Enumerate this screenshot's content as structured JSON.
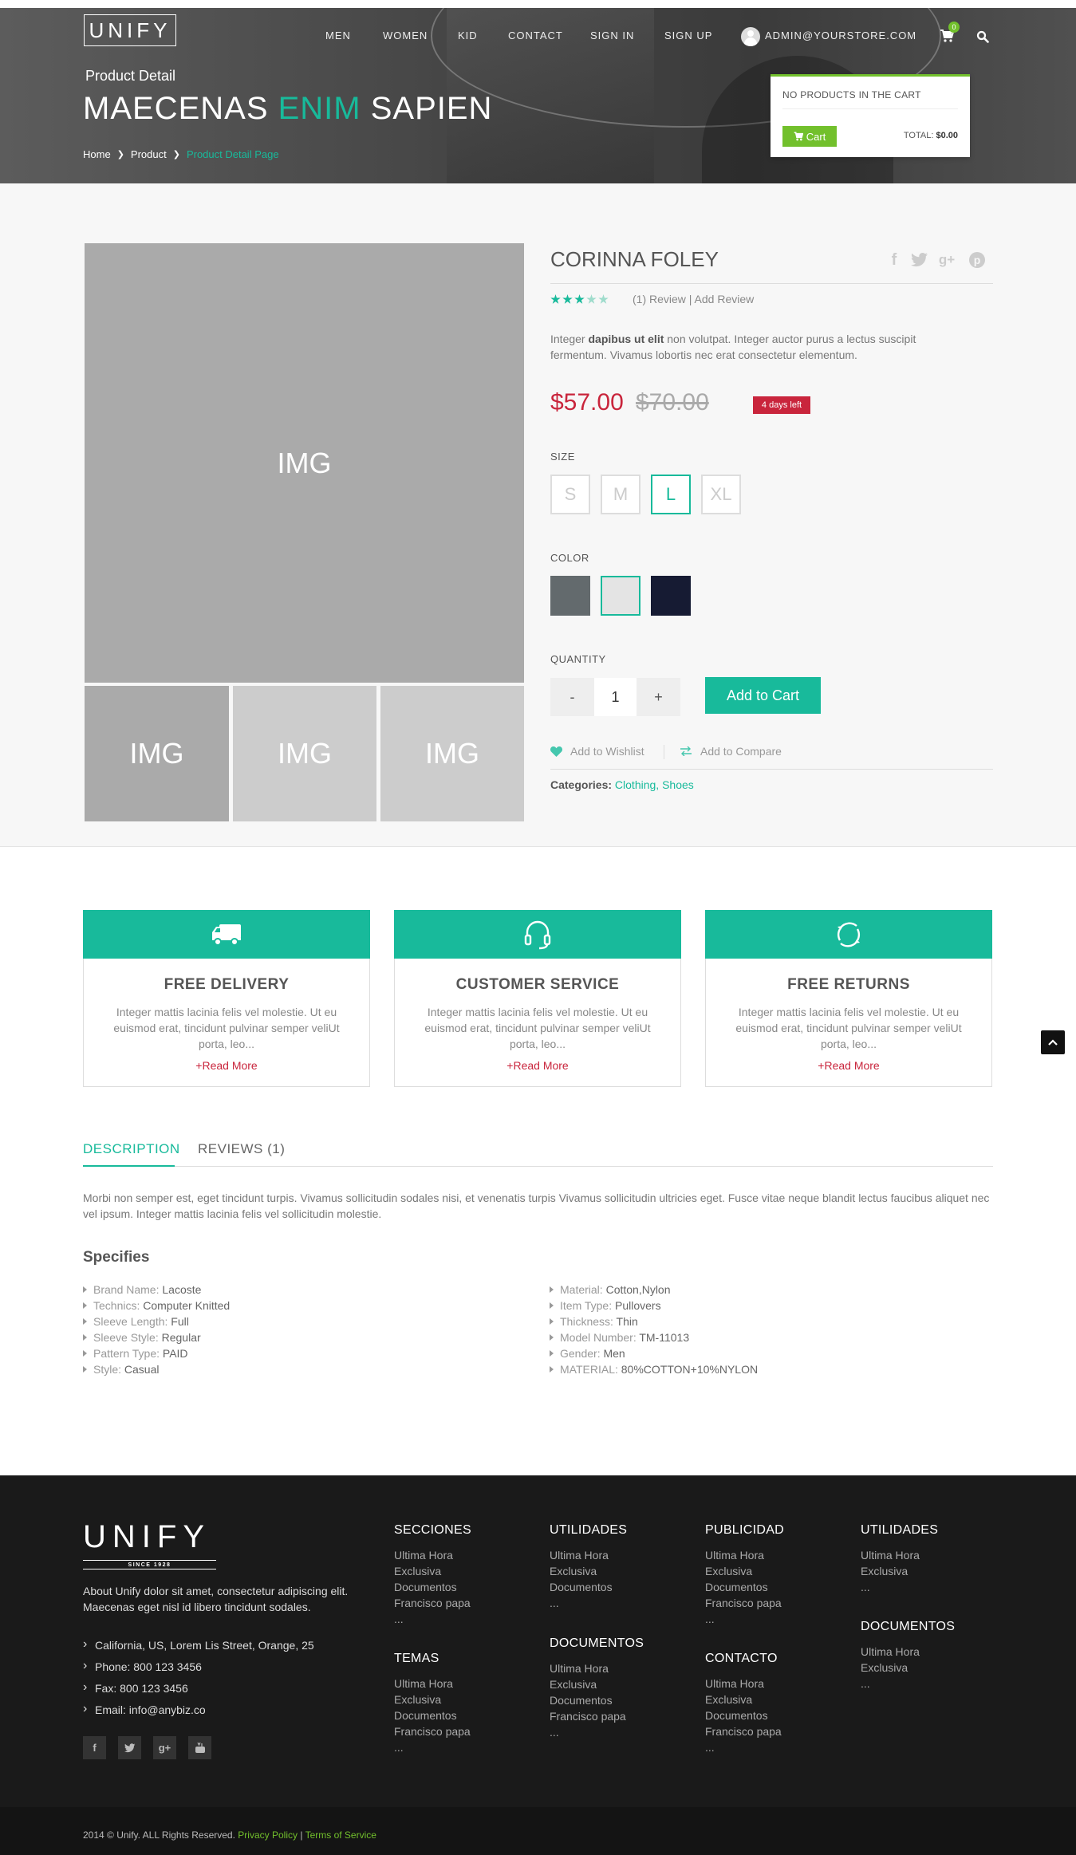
{
  "header": {
    "logo": "UNIFY",
    "nav": [
      "MEN",
      "WOMEN",
      "KID",
      "CONTACT",
      "SIGN IN",
      "SIGN UP"
    ],
    "user_email": "ADMIN@YOURSTORE.COM",
    "cart_count": "0",
    "subtitle": "Product Detail",
    "title_part1": "MAECENAS ",
    "title_highlight": "ENIM",
    "title_part2": " SAPIEN",
    "breadcrumb": [
      "Home",
      "Product",
      "Product Detail Page"
    ],
    "accent_color": "#18ba9b"
  },
  "cart_dropdown": {
    "empty_text": "NO PRODUCTS IN THE CART",
    "button": "Cart",
    "total_label": "TOTAL:",
    "total_value": "$0.00"
  },
  "product": {
    "images": [
      "IMG",
      "IMG",
      "IMG",
      "IMG"
    ],
    "name": "CORINNA FOLEY",
    "rating": 3,
    "rating_max": 5,
    "reviews_link": "(1) Review | Add Review",
    "desc_pre": "Integer ",
    "desc_bold": "dapibus ut elit",
    "desc_post": " non volutpat. Integer auctor purus a lectus suscipit fermentum. Vivamus lobortis nec erat consectetur elementum.",
    "price": "$57.00",
    "old_price": "$70.00",
    "stock_badge": "4 days left",
    "size_label": "SIZE",
    "sizes": [
      "S",
      "M",
      "L",
      "XL"
    ],
    "selected_size": "L",
    "color_label": "COLOR",
    "colors": [
      "#636a6d",
      "#e4e4e4",
      "#161b33"
    ],
    "quantity_label": "QUANTITY",
    "qty_minus": "-",
    "qty_value": "1",
    "qty_plus": "+",
    "add_to_cart": "Add to Cart",
    "wishlist": "Add to Wishlist",
    "compare": "Add to Compare",
    "categories_label": "Categories:",
    "categories": "Clothing, Shoes"
  },
  "services": [
    {
      "title": "FREE DELIVERY",
      "text": "Integer mattis lacinia felis vel molestie. Ut eu euismod erat, tincidunt pulvinar semper veliUt porta, leo...",
      "more": "+Read More",
      "icon": "truck-icon"
    },
    {
      "title": "CUSTOMER SERVICE",
      "text": "Integer mattis lacinia felis vel molestie. Ut eu euismod erat, tincidunt pulvinar semper veliUt porta, leo...",
      "more": "+Read More",
      "icon": "headset-icon"
    },
    {
      "title": "FREE RETURNS",
      "text": "Integer mattis lacinia felis vel molestie. Ut eu euismod erat, tincidunt pulvinar semper veliUt porta, leo...",
      "more": "+Read More",
      "icon": "refresh-icon"
    }
  ],
  "tabs": {
    "items": [
      "DESCRIPTION",
      "REVIEWS (1)"
    ],
    "description": "Morbi non semper est, eget tincidunt turpis. Vivamus sollicitudin sodales nisi, et venenatis turpis Vivamus sollicitudin ultricies eget. Fusce vitae neque blandit lectus faucibus aliquet nec vel ipsum. Integer mattis lacinia felis vel sollicitudin molestie.",
    "specifies_title": "Specifies",
    "specs_left": [
      {
        "k": "Brand Name: ",
        "v": "Lacoste"
      },
      {
        "k": "Technics: ",
        "v": "Computer Knitted"
      },
      {
        "k": "Sleeve Length: ",
        "v": "Full"
      },
      {
        "k": "Sleeve Style: ",
        "v": "Regular"
      },
      {
        "k": "Pattern Type: ",
        "v": "PAID"
      },
      {
        "k": "Style: ",
        "v": "Casual"
      }
    ],
    "specs_right": [
      {
        "k": "Material: ",
        "v": "Cotton,Nylon"
      },
      {
        "k": "Item Type: ",
        "v": "Pullovers"
      },
      {
        "k": "Thickness: ",
        "v": "Thin"
      },
      {
        "k": "Model Number: ",
        "v": "TM-11013"
      },
      {
        "k": "Gender: ",
        "v": "Men"
      },
      {
        "k": "MATERIAL: ",
        "v": "80%COTTON+10%NYLON"
      }
    ]
  },
  "footer": {
    "logo": "UNIFY",
    "since": "SINCE 1928",
    "about": "About Unify dolor sit amet, consectetur adipiscing elit. Maecenas eget nisl id libero tincidunt sodales.",
    "contact": [
      "California, US, Lorem Lis Street, Orange, 25",
      "Phone: 800 123 3456",
      "Fax: 800 123 3456",
      "Email: info@anybiz.co"
    ],
    "social": [
      "f",
      "t",
      "g+",
      "yt"
    ],
    "columns": [
      {
        "title": "SECCIONES",
        "items": [
          "Ultima Hora",
          "Exclusiva",
          "Documentos",
          "Francisco papa",
          "..."
        ]
      },
      {
        "title": "TEMAS",
        "items": [
          "Ultima Hora",
          "Exclusiva",
          "Documentos",
          "Francisco papa",
          "..."
        ]
      },
      {
        "title": "UTILIDADES",
        "items": [
          "Ultima Hora",
          "Exclusiva",
          "Documentos",
          "..."
        ]
      },
      {
        "title": "DOCUMENTOS",
        "items": [
          "Ultima Hora",
          "Exclusiva",
          "Documentos",
          "Francisco papa",
          "..."
        ]
      },
      {
        "title": "PUBLICIDAD",
        "items": [
          "Ultima Hora",
          "Exclusiva",
          "Documentos",
          "Francisco papa",
          "..."
        ]
      },
      {
        "title": "CONTACTO",
        "items": [
          "Ultima Hora",
          "Exclusiva",
          "Documentos",
          "Francisco papa",
          "..."
        ]
      },
      {
        "title": "UTILIDADES",
        "items": [
          "Ultima Hora",
          "Exclusiva",
          "..."
        ]
      },
      {
        "title": "DOCUMENTOS",
        "items": [
          "Ultima Hora",
          "Exclusiva",
          "..."
        ]
      }
    ],
    "copyright": "2014 © Unify. ALL Rights Reserved.",
    "privacy": "Privacy Policy",
    "divider": "|",
    "terms": "Terms of Service"
  }
}
